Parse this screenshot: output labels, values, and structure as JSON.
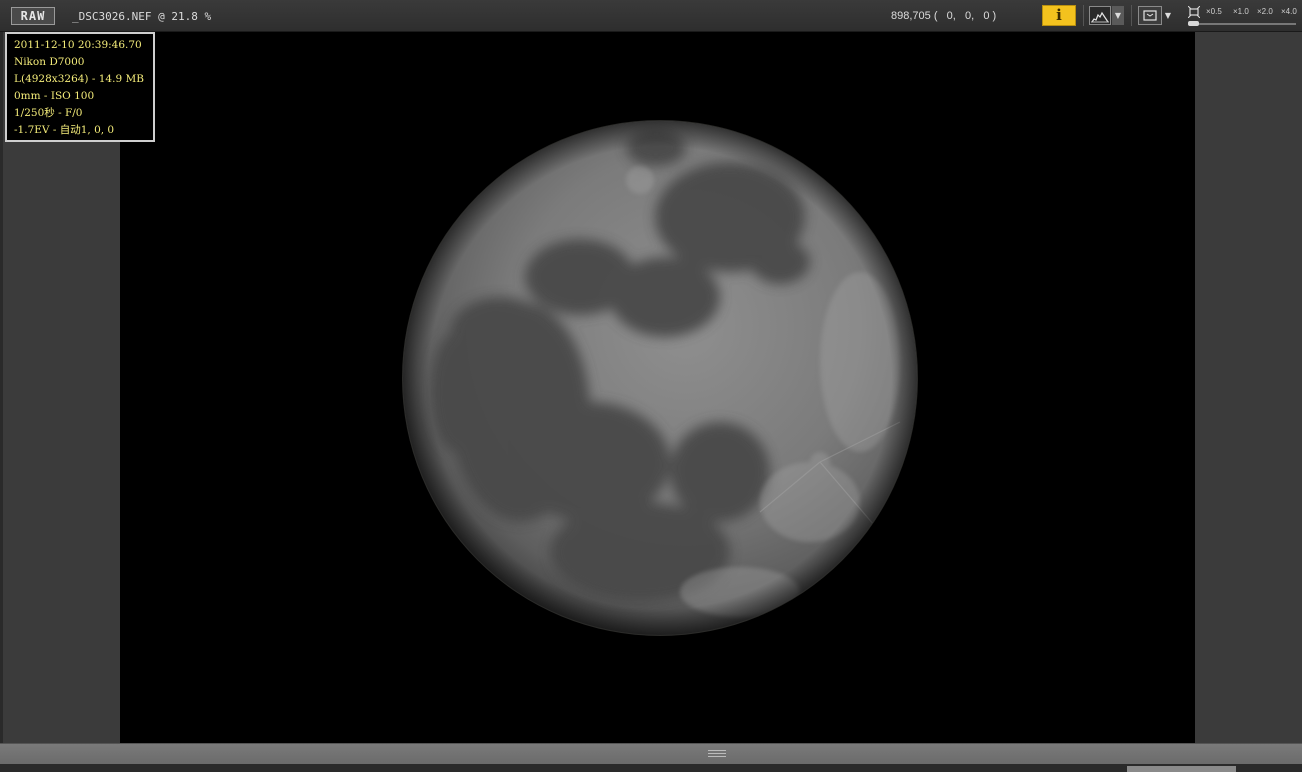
{
  "toolbar": {
    "raw_label": "RAW",
    "file_info": "_DSC3026.NEF @ 21.8 %",
    "pixel_readout": "898,705 (   0,   0,   0 )",
    "info_label": "i",
    "zoom_levels": [
      "×0.5",
      "×1.0",
      "×2.0",
      "×4.0"
    ],
    "zoom_fraction": 0.0
  },
  "exif": {
    "lines": [
      "2011-12-10 20:39:46.70",
      "Nikon D7000",
      "L(4928x3264) - 14.9 MB",
      "0mm - ISO 100",
      "1/250秒 - F/0",
      "-1.7EV - 自动1, 0, 0"
    ]
  },
  "colors": {
    "accent": "#f3c21e",
    "exif_text": "#f5ed7a",
    "canvas_bg": "#000000",
    "panel_bg": "#3b3b3b"
  },
  "icons": {
    "histogram": "histogram-icon",
    "fit": "fit-screen-icon",
    "zoom_fit": "zoom-fit-icon",
    "dropdown": "chevron-down-icon"
  }
}
